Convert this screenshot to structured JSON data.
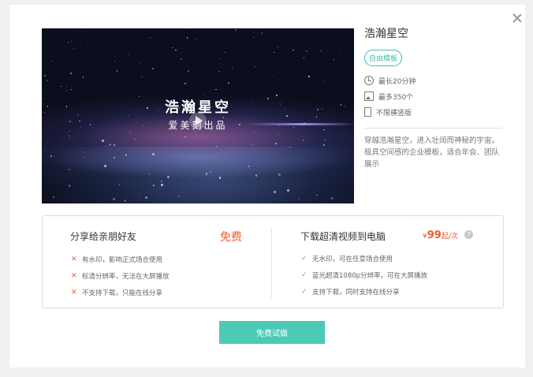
{
  "dialog": {
    "close_icon": "close-icon"
  },
  "preview": {
    "title": "浩瀚星空",
    "subtitle": "爱美刻出品",
    "play_icon": "play-icon"
  },
  "template": {
    "name": "浩瀚星空",
    "tag": "自由模板",
    "meta": [
      {
        "icon": "clock-icon",
        "text": "最长20分钟"
      },
      {
        "icon": "image-icon",
        "text": "最多350个"
      },
      {
        "icon": "screen-icon",
        "text": "不限横竖版"
      }
    ],
    "description": "穿越浩瀚星空，进入壮阔而神秘的宇宙。极具空间感的企业模板，适合年会、团队展示"
  },
  "compare": {
    "free": {
      "heading": "分享给亲朋好友",
      "badge": "免费",
      "features": [
        "有水印，影响正式场合使用",
        "标清分辨率，无法在大屏播放",
        "不支持下载，只能在线分享"
      ]
    },
    "paid": {
      "heading": "下载超清视频到电脑",
      "price_symbol": "¥",
      "price_value": "99",
      "price_unit": "起/次",
      "help_icon": "help-icon",
      "features": [
        "无水印，可在任意场合使用",
        "蓝光超清1080p分辨率，可在大屏播放",
        "支持下载，同时支持在线分享"
      ]
    }
  },
  "cta": {
    "label": "免费试做"
  },
  "colors": {
    "accent": "#4dcab5",
    "price": "#f05b2f",
    "cross": "#e85b3a",
    "check": "#3cc3a9"
  }
}
